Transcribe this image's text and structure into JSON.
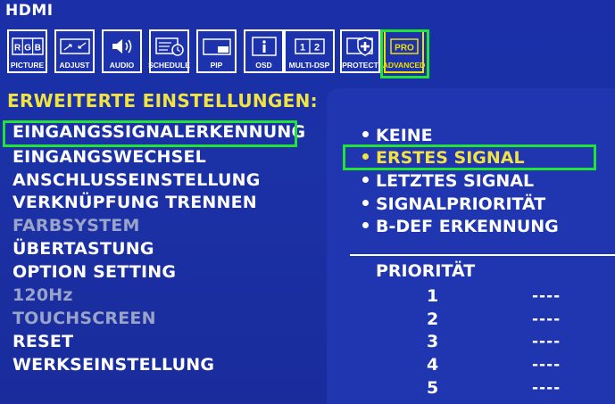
{
  "window": {
    "title": "HDMI"
  },
  "tabs": [
    {
      "label": "PICTURE",
      "icon": "rgb-icon",
      "glyph": "RGB"
    },
    {
      "label": "ADJUST",
      "icon": "adjust-icon"
    },
    {
      "label": "AUDIO",
      "icon": "speaker-icon"
    },
    {
      "label": "SCHEDULE",
      "icon": "schedule-icon"
    },
    {
      "label": "PIP",
      "icon": "pip-icon"
    },
    {
      "label": "OSD",
      "icon": "info-icon",
      "glyph": "i"
    },
    {
      "label": "MULTI-DSP",
      "icon": "multi-display-icon",
      "glyph": "1 2"
    },
    {
      "label": "PROTECT",
      "icon": "shield-plus-icon"
    },
    {
      "label": "ADVANCED",
      "icon": "pro-icon",
      "glyph": "PRO"
    }
  ],
  "section_title": "ERWEITERTE EINSTELLUNGEN:",
  "menu": [
    {
      "label": "EINGANGSSIGNALERKENNUNG",
      "enabled": true,
      "selected": true
    },
    {
      "label": "EINGANGSWECHSEL",
      "enabled": true
    },
    {
      "label": "ANSCHLUSSEINSTELLUNG",
      "enabled": true
    },
    {
      "label": "VERKNÜPFUNG TRENNEN",
      "enabled": true
    },
    {
      "label": "FARBSYSTEM",
      "enabled": false
    },
    {
      "label": "ÜBERTASTUNG",
      "enabled": true
    },
    {
      "label": "OPTION SETTING",
      "enabled": true
    },
    {
      "label": "120Hz",
      "enabled": false
    },
    {
      "label": "TOUCHSCREEN",
      "enabled": false
    },
    {
      "label": "RESET",
      "enabled": true
    },
    {
      "label": "WERKSEINSTELLUNG",
      "enabled": true
    }
  ],
  "options": [
    {
      "label": "KEINE",
      "selected": false
    },
    {
      "label": "ERSTES SIGNAL",
      "selected": true
    },
    {
      "label": "LETZTES SIGNAL",
      "selected": false
    },
    {
      "label": "SIGNALPRIORITÄT",
      "selected": false
    },
    {
      "label": "B-DEF ERKENNUNG",
      "selected": false
    }
  ],
  "priority": {
    "heading": "PRIORITÄT",
    "rows": [
      {
        "num": "1",
        "value": "----"
      },
      {
        "num": "2",
        "value": "----"
      },
      {
        "num": "3",
        "value": "----"
      },
      {
        "num": "4",
        "value": "----"
      },
      {
        "num": "5",
        "value": "----"
      }
    ]
  },
  "colors": {
    "background": "#1a2fa8",
    "panel": "#1f36b0",
    "highlight": "#22e233",
    "accent": "#f1e341",
    "disabled": "#9aa3c8"
  }
}
